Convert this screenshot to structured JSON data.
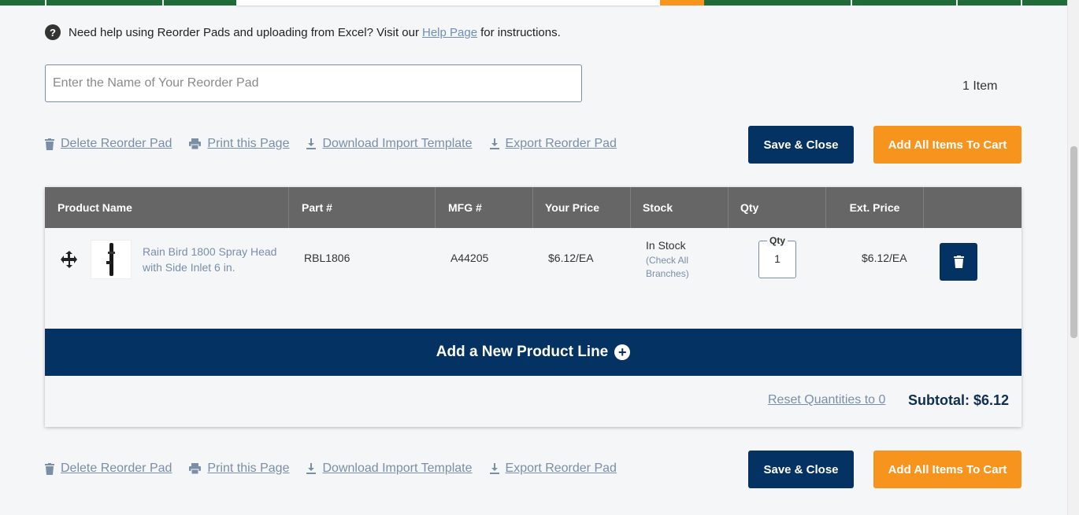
{
  "help": {
    "text_before": "Need help using Reorder Pads and uploading from Excel? Visit our",
    "link": "Help Page",
    "text_after": "for instructions."
  },
  "pad_name": {
    "placeholder": "Enter the Name of Your Reorder Pad",
    "value": ""
  },
  "item_count": "1 Item",
  "actions": {
    "delete": "Delete Reorder Pad",
    "print": "Print this Page",
    "download": "Download Import Template",
    "export": "Export Reorder Pad"
  },
  "buttons": {
    "save": "Save & Close",
    "add_all": "Add All Items To Cart"
  },
  "table": {
    "headers": {
      "product": "Product Name",
      "part": "Part #",
      "mfg": "MFG #",
      "price": "Your Price",
      "stock": "Stock",
      "qty": "Qty",
      "ext": "Ext. Price"
    },
    "rows": [
      {
        "product": "Rain Bird 1800 Spray Head with Side Inlet 6 in.",
        "part": "RBL1806",
        "mfg": "A44205",
        "price": "$6.12/EA",
        "stock": "In Stock",
        "stock_note": "(Check All Branches)",
        "qty_label": "Qty",
        "qty": "1",
        "ext": "$6.12/EA"
      }
    ]
  },
  "add_line": "Add a New Product Line",
  "reset": "Reset Quantities to 0",
  "subtotal": "Subtotal: $6.12",
  "colors": {
    "navy": "#043263",
    "orange": "#f7941d",
    "green": "#1f6b3a",
    "header_gray": "#666666"
  }
}
